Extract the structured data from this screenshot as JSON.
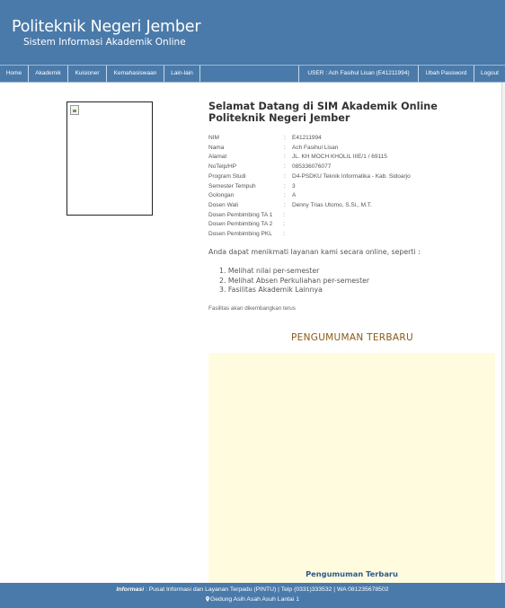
{
  "header": {
    "title": "Politeknik Negeri Jember",
    "subtitle": "Sistem Informasi Akademik Online"
  },
  "nav": {
    "items": [
      "Home",
      "Akademik",
      "Kuisioner",
      "Kemahasiswaan",
      "Lain-lain"
    ],
    "user": "USER : Ach Fasihul Lisan (E41211994)",
    "change_password": "Ubah Password",
    "logout": "Logout"
  },
  "profile": {
    "photo_icon": "broken-image-icon"
  },
  "welcome": {
    "line1": "Selamat Datang di SIM Akademik Online",
    "line2": "Politeknik Negeri Jember"
  },
  "student_info": [
    {
      "label": "NIM",
      "value": "E41211994"
    },
    {
      "label": "Nama",
      "value": "Ach Fasihul Lisan"
    },
    {
      "label": "Alamat",
      "value": "JL. KH MOCH KHOLIL IIIE/1 / 69115"
    },
    {
      "label": "NoTelp/HP",
      "value": "085336076077"
    },
    {
      "label": "Program Studi",
      "value": "D4-PSDKU Teknik Informatika - Kab. Sidoarjo"
    },
    {
      "label": "Semester Tempuh",
      "value": "3"
    },
    {
      "label": "Golongan",
      "value": "A"
    },
    {
      "label": "Dosen Wali",
      "value": "Denny Trias Utomo, S.Si., M.T."
    },
    {
      "label": "Dosen Pembimbing TA 1",
      "value": ""
    },
    {
      "label": "Dosen Pembimbing TA 2",
      "value": ""
    },
    {
      "label": "Dosen Pembimbing PKL",
      "value": ""
    }
  ],
  "colon": ":",
  "intro": "Anda dapat menikmati layanan kami secara online, seperti :",
  "services": [
    "1. Melihat nilai per-semester",
    "2. Melihat Absen Perkuliahan per-semester",
    "3. Fasilitas Akademik Lainnya"
  ],
  "note": "Fasilitas akan dikembangkan terus",
  "announcements": {
    "heading": "PENGUMUMAN TERBARU",
    "box_title": "Pengumuman Terbaru"
  },
  "footer": {
    "info_label": "Informasi",
    "info_text": ": Pusat Informasi dan Layanan Terpadu (PINTU) | Telp (0331)333532 | WA 081235678502",
    "address": "Gedung Asih Asah Asuh Lantai 1",
    "location_icon": "map-pin-icon"
  },
  "colors": {
    "brand_blue": "#4a7aaa",
    "announcement_bg": "#fffbdf",
    "announcement_heading": "#8a5a18"
  }
}
